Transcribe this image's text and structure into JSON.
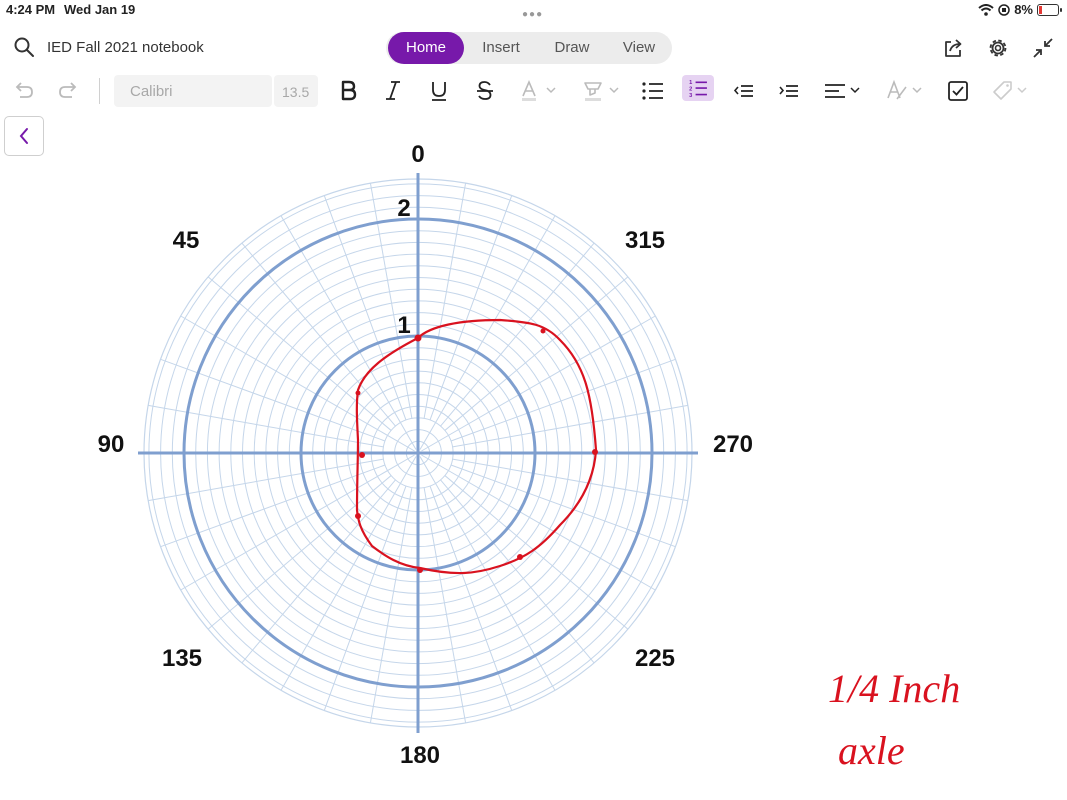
{
  "status_bar": {
    "time": "4:24 PM",
    "date": "Wed Jan 19",
    "battery": "8%"
  },
  "title_bar": {
    "notebook_title": "IED Fall 2021 notebook"
  },
  "tabs": [
    {
      "label": "Home",
      "active": true
    },
    {
      "label": "Insert",
      "active": false
    },
    {
      "label": "Draw",
      "active": false
    },
    {
      "label": "View",
      "active": false
    }
  ],
  "toolbar": {
    "font_name": "Calibri",
    "font_size": "13.5"
  },
  "polar_chart": {
    "angle_labels": [
      "0",
      "45",
      "90",
      "135",
      "180",
      "225",
      "270",
      "315"
    ],
    "radius_labels": [
      "1",
      "2"
    ]
  },
  "colors": {
    "accent": "#7719aa",
    "grid_major": "#7f9fcf",
    "grid_minor": "#c5d6ea",
    "ink": "#d9121f"
  },
  "handwriting": [
    "1/4 Inch",
    "axle"
  ]
}
